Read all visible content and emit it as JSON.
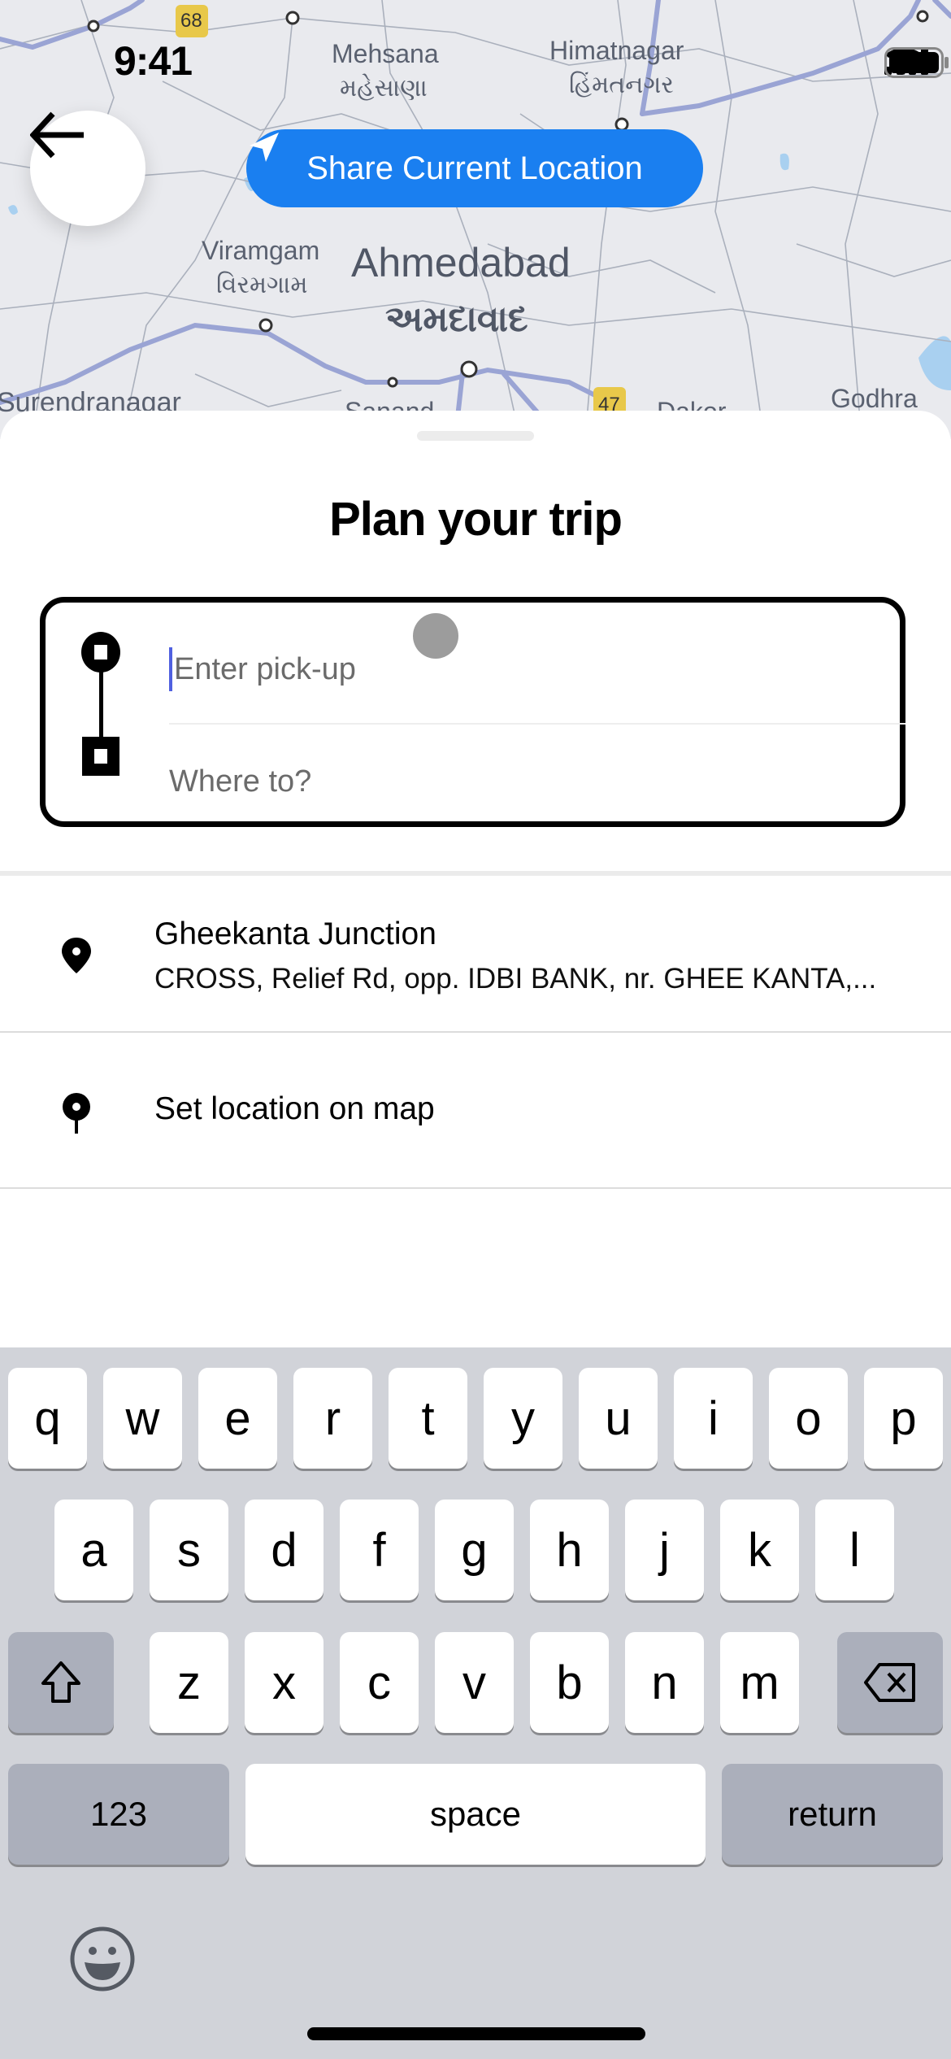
{
  "status_bar": {
    "time": "9:41",
    "icons": [
      "cellular-signal-icon",
      "wifi-icon",
      "battery-icon"
    ]
  },
  "map": {
    "labels": [
      {
        "text": "Mehsana",
        "kind": "city"
      },
      {
        "text": "મહેસાણા",
        "kind": "city-local"
      },
      {
        "text": "Himatnagar",
        "kind": "city"
      },
      {
        "text": "હિંમતનગર",
        "kind": "city-local"
      },
      {
        "text": "Viramgam",
        "kind": "city"
      },
      {
        "text": "વિરમગામ",
        "kind": "city-local"
      },
      {
        "text": "Ahmedabad",
        "kind": "major-city"
      },
      {
        "text": "અમદાવાદ",
        "kind": "major-city-local"
      },
      {
        "text": "Surendranagar",
        "kind": "city"
      },
      {
        "text": "Sanand",
        "kind": "city"
      },
      {
        "text": "Dakor",
        "kind": "city"
      },
      {
        "text": "Godhra",
        "kind": "city"
      }
    ],
    "highway_shields": [
      "68",
      "47"
    ],
    "colors": {
      "background": "#e9eaee",
      "highway": "#9aa4d4",
      "road": "#a8aeb8",
      "water": "#a9d0f0",
      "shield": "#e8c84a"
    }
  },
  "header": {
    "back_icon": "arrow-left-icon",
    "share_location": {
      "label": "Share Current Location",
      "icon": "location-arrow-icon",
      "color": "#1a7ff0"
    }
  },
  "sheet": {
    "title": "Plan your trip",
    "pickup": {
      "placeholder": "Enter pick-up",
      "value": "",
      "focused": true
    },
    "destination": {
      "placeholder": "Where to?",
      "value": ""
    },
    "results": [
      {
        "title": "Gheekanta Junction",
        "subtitle": "CROSS, Relief Rd, opp. IDBI BANK, nr. GHEE KANTA,...",
        "icon": "location-pin-icon"
      },
      {
        "title": "Set location on map",
        "subtitle": "",
        "icon": "map-pin-icon"
      }
    ]
  },
  "keyboard": {
    "row1": [
      "q",
      "w",
      "e",
      "r",
      "t",
      "y",
      "u",
      "i",
      "o",
      "p"
    ],
    "row2": [
      "a",
      "s",
      "d",
      "f",
      "g",
      "h",
      "j",
      "k",
      "l"
    ],
    "row3": [
      "z",
      "x",
      "c",
      "v",
      "b",
      "n",
      "m"
    ],
    "shift_icon": "shift-icon",
    "delete_icon": "backspace-icon",
    "numbers_label": "123",
    "space_label": "space",
    "return_label": "return",
    "emoji_icon": "emoji-icon"
  }
}
